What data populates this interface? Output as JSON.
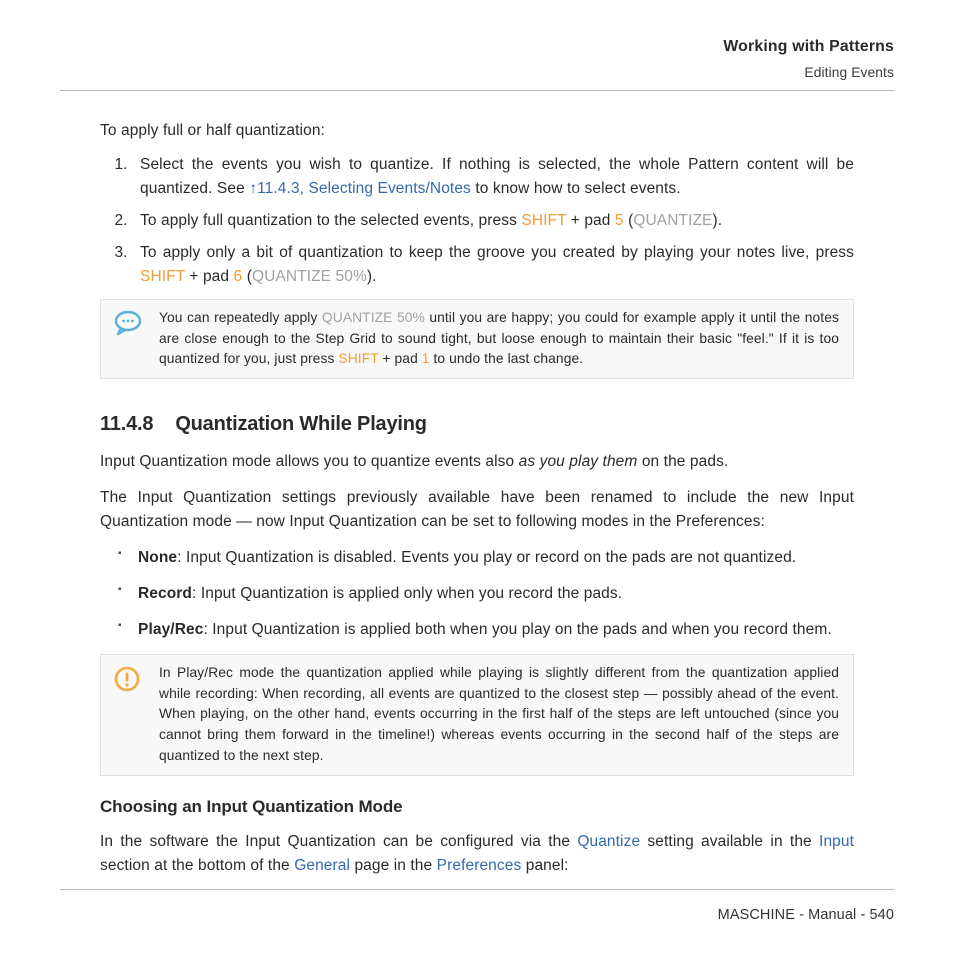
{
  "header": {
    "chapter": "Working with Patterns",
    "section": "Editing Events"
  },
  "intro": "To apply full or half quantization:",
  "steps": {
    "s1a": "Select the events you wish to quantize. If nothing is selected, the whole Pattern content will be quantized. See ",
    "s1link": "↑11.4.3, Selecting Events/Notes",
    "s1b": " to know how to select events.",
    "s2a": "To apply full quantization to the selected events, press ",
    "s2_shift": "SHIFT",
    "s2_mid": " + pad ",
    "s2_pad": "5",
    "s2_open": " (",
    "s2_qlabel": "QUANTIZE",
    "s2_close": ").",
    "s3a": "To apply only a bit of quantization to keep the groove you created by playing your notes live, press ",
    "s3_shift": "SHIFT",
    "s3_mid": " + pad ",
    "s3_pad": "6",
    "s3_open": " (",
    "s3_qlabel": "QUANTIZE 50%",
    "s3_close": ")."
  },
  "tip": {
    "a": "You can repeatedly apply ",
    "q50": "QUANTIZE 50%",
    "b": " until you are happy; you could for example apply it until the notes are close enough to the Step Grid to sound tight, but loose enough to maintain their basic \"feel.\" If it is too quantized for you, just press ",
    "shift": "SHIFT",
    "mid": " + pad ",
    "pad": "1",
    "c": " to undo the last change."
  },
  "sec": {
    "num": "11.4.8",
    "title": "Quantization While Playing"
  },
  "p1a": "Input Quantization mode allows you to quantize events also ",
  "p1em": "as you play them",
  "p1b": " on the pads.",
  "p2": "The Input Quantization settings previously available have been renamed to include the new Input Quantization mode — now Input Quantization can be set to following modes in the Preferences:",
  "bul": {
    "b1_label": "None",
    "b1_text": ": Input Quantization is disabled. Events you play or record on the pads are not quantized.",
    "b2_label": "Record",
    "b2_text": ": Input Quantization is applied only when you record the pads.",
    "b3_label": "Play/Rec",
    "b3_text": ": Input Quantization is applied both when you play on the pads and when you record them."
  },
  "note": "In Play/Rec mode the quantization applied while playing is slightly different from the quantization applied while recording: When recording, all events are quantized to the closest step — possibly ahead of the event. When playing, on the other hand, events occurring in the first half of the steps are left untouched (since you cannot bring them forward in the timeline!) whereas events occurring in the second half of the steps are quantized to the next step.",
  "sub2": "Choosing an Input Quantization Mode",
  "p3a": "In the software the Input Quantization can be configured via the ",
  "p3_quantize": "Quantize",
  "p3b": " setting available in the ",
  "p3_input": "Input",
  "p3c": " section at the bottom of the ",
  "p3_general": "General",
  "p3d": " page in the ",
  "p3_prefs": "Preferences",
  "p3e": " panel:",
  "footer": "MASCHINE - Manual - 540"
}
